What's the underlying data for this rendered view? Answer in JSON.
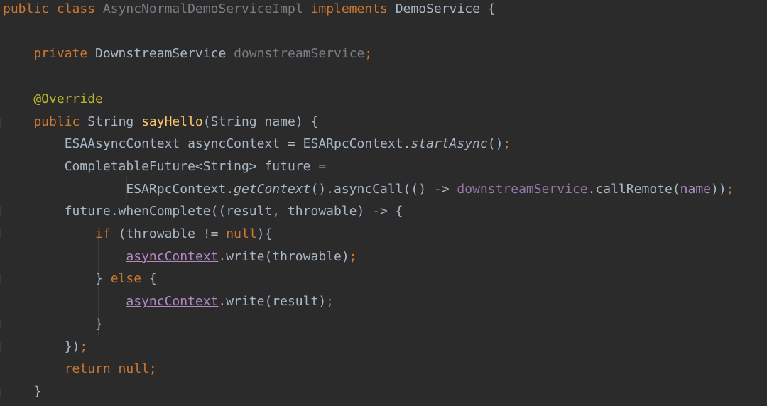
{
  "lines": [
    {
      "tokens": [
        {
          "text": "public class ",
          "cls": "kw"
        },
        {
          "text": "AsyncNormalDemoServiceImpl",
          "cls": "muted"
        },
        {
          "text": " implements ",
          "cls": "kw"
        },
        {
          "text": "DemoService {",
          "cls": ""
        }
      ]
    },
    {
      "tokens": []
    },
    {
      "tokens": [
        {
          "text": "    private ",
          "cls": "kw"
        },
        {
          "text": "DownstreamService ",
          "cls": ""
        },
        {
          "text": "downstreamService",
          "cls": "muted"
        },
        {
          "text": ";",
          "cls": "kw"
        }
      ]
    },
    {
      "tokens": []
    },
    {
      "tokens": [
        {
          "text": "    @Override",
          "cls": "ann"
        }
      ]
    },
    {
      "tokens": [
        {
          "text": "    public ",
          "cls": "kw"
        },
        {
          "text": "String ",
          "cls": ""
        },
        {
          "text": "sayHello",
          "cls": "fn"
        },
        {
          "text": "(String name) {",
          "cls": ""
        }
      ]
    },
    {
      "tokens": [
        {
          "text": "        ESAAsyncContext asyncContext = ESARpcContext.",
          "cls": ""
        },
        {
          "text": "startAsync",
          "cls": "ital"
        },
        {
          "text": "()",
          "cls": ""
        },
        {
          "text": ";",
          "cls": "kw"
        }
      ]
    },
    {
      "tokens": [
        {
          "text": "        CompletableFuture<String> future =",
          "cls": ""
        }
      ]
    },
    {
      "tokens": [
        {
          "text": "                ESARpcContext.",
          "cls": ""
        },
        {
          "text": "getContext",
          "cls": "ital"
        },
        {
          "text": "().asyncCall(() -> ",
          "cls": ""
        },
        {
          "text": "downstreamService",
          "cls": "fld"
        },
        {
          "text": ".callRemote(",
          "cls": ""
        },
        {
          "text": "name",
          "cls": "nm"
        },
        {
          "text": "))",
          "cls": ""
        },
        {
          "text": ";",
          "cls": "kw"
        }
      ]
    },
    {
      "tokens": [
        {
          "text": "        future.whenComplete((result, throwable) -> {",
          "cls": ""
        }
      ]
    },
    {
      "tokens": [
        {
          "text": "            if ",
          "cls": "kw"
        },
        {
          "text": "(throwable != ",
          "cls": ""
        },
        {
          "text": "null",
          "cls": "kw"
        },
        {
          "text": "){",
          "cls": ""
        }
      ]
    },
    {
      "tokens": [
        {
          "text": "                ",
          "cls": ""
        },
        {
          "text": "asyncContext",
          "cls": "pu"
        },
        {
          "text": ".write(throwable)",
          "cls": ""
        },
        {
          "text": ";",
          "cls": "kw"
        }
      ]
    },
    {
      "tokens": [
        {
          "text": "            } ",
          "cls": ""
        },
        {
          "text": "else ",
          "cls": "kw"
        },
        {
          "text": "{",
          "cls": ""
        }
      ]
    },
    {
      "tokens": [
        {
          "text": "                ",
          "cls": ""
        },
        {
          "text": "asyncContext",
          "cls": "pu"
        },
        {
          "text": ".write(result)",
          "cls": ""
        },
        {
          "text": ";",
          "cls": "kw"
        }
      ]
    },
    {
      "tokens": [
        {
          "text": "            }",
          "cls": ""
        }
      ]
    },
    {
      "tokens": [
        {
          "text": "        })",
          "cls": ""
        },
        {
          "text": ";",
          "cls": "kw"
        }
      ]
    },
    {
      "tokens": [
        {
          "text": "        return null;",
          "cls": "kw"
        }
      ]
    },
    {
      "tokens": [
        {
          "text": "    }",
          "cls": ""
        }
      ]
    }
  ]
}
